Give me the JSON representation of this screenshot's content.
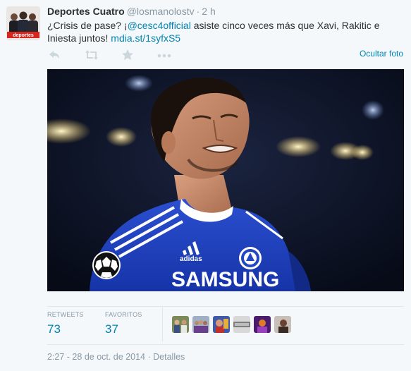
{
  "tweet": {
    "fullname": "Deportes Cuatro",
    "username": "@losmanolostv",
    "separator": "·",
    "time": "2 h",
    "text_part1": "¿Crisis de pase? ¡",
    "mention": "@cesc4official",
    "text_part2": " asiste cinco veces más que Xavi, Rakitic e Iniesta juntos! ",
    "link": "mdia.st/1syfxS5",
    "avatar_badge": "deportes"
  },
  "actions": {
    "reply_icon": "reply-icon",
    "retweet_icon": "retweet-icon",
    "favorite_icon": "star-icon",
    "more_icon": "more-icon",
    "hide_photo_label": "Ocultar foto"
  },
  "photo": {
    "shirt_text": "SAMSUNG",
    "brand_text": "adidas",
    "colors": {
      "shirt": "#1f3fbf",
      "background": "#0c1324"
    }
  },
  "stats": {
    "retweets_label": "RETWEETS",
    "retweets_value": "73",
    "favorites_label": "FAVORITOS",
    "favorites_value": "37"
  },
  "footer": {
    "timestamp": "2:27 - 28 de oct. de 2014",
    "separator": "·",
    "details_label": "Detalles"
  },
  "colors": {
    "link": "#0084b4",
    "muted": "#8899a6",
    "text": "#292f33",
    "background": "#f5f8fa"
  }
}
